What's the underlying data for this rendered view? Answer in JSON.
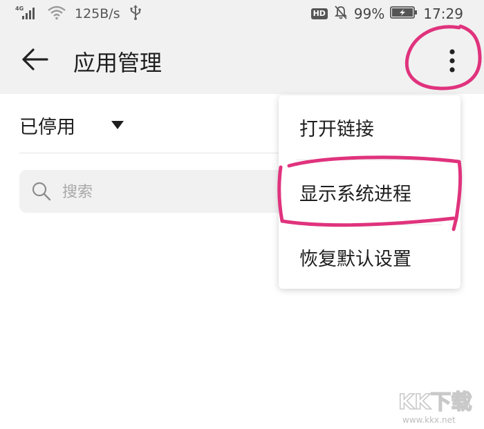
{
  "status_bar": {
    "network_type": "4G",
    "net_speed": "125B/s",
    "hd_badge": "HD",
    "battery_percent": "99%",
    "time": "17:29",
    "icons": [
      "signal-icon",
      "wifi-icon",
      "usb-icon",
      "mute-bell-icon",
      "battery-charging-icon"
    ]
  },
  "app_bar": {
    "title": "应用管理",
    "back_icon": "back-arrow-icon",
    "more_icon": "more-vertical-icon"
  },
  "filter": {
    "selected": "已停用",
    "dropdown_icon": "caret-down-icon"
  },
  "search": {
    "placeholder": "搜索",
    "value": "",
    "icon": "search-icon"
  },
  "menu": {
    "items": [
      {
        "label": "打开链接"
      },
      {
        "label": "显示系统进程"
      },
      {
        "label": "恢复默认设置"
      }
    ]
  },
  "annotation": {
    "color": "#e0337d"
  },
  "watermark": {
    "logo_text": "KK下载",
    "url": "www.kkx.net"
  }
}
